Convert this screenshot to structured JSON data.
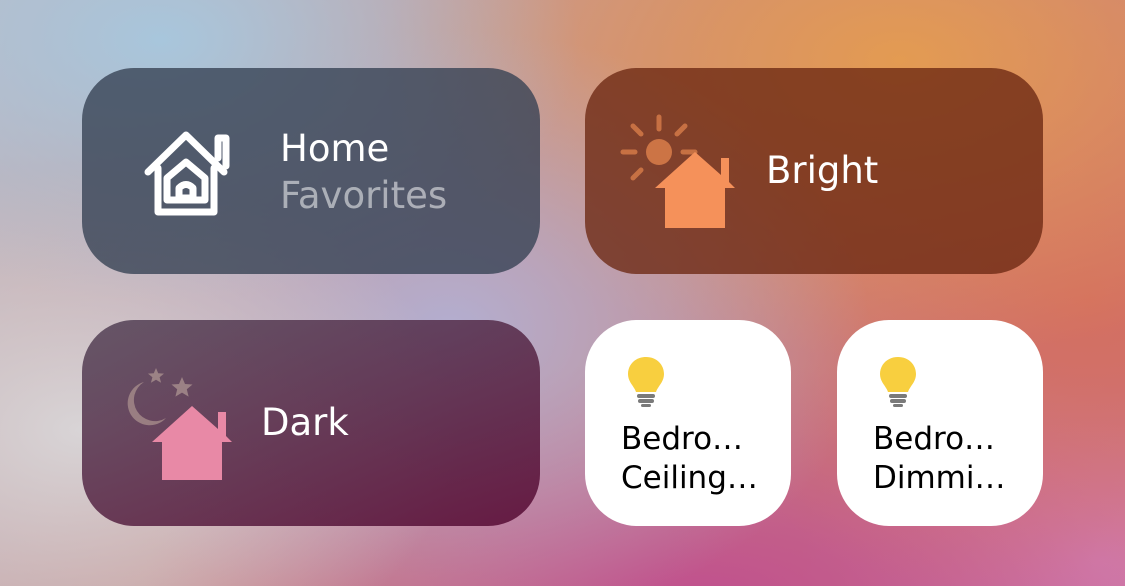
{
  "scenes": [
    {
      "id": "home",
      "title": "Home",
      "subtitle": "Favorites",
      "icon": "home-outline-icon"
    },
    {
      "id": "bright",
      "title": "Bright",
      "icon": "sun-house-icon",
      "accent": "#f5915a"
    },
    {
      "id": "dark",
      "title": "Dark",
      "icon": "moon-stars-house-icon",
      "accent": "#e889a6"
    }
  ],
  "accessories": [
    {
      "line1": "Bedro…",
      "line2": "Ceiling…",
      "icon": "lightbulb-icon",
      "state": "on"
    },
    {
      "line1": "Bedro…",
      "line2": "Dimmi…",
      "icon": "lightbulb-icon",
      "state": "on"
    }
  ],
  "colors": {
    "bulb": "#f8cf3f",
    "bright_house": "#f5915a",
    "dark_house": "#e889a6"
  }
}
